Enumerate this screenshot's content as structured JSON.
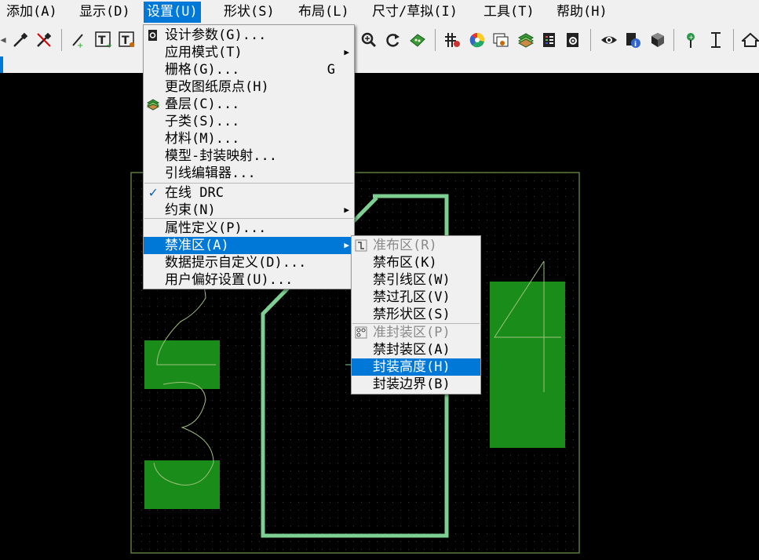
{
  "menubar": {
    "items": [
      {
        "label": "添加(A)"
      },
      {
        "label": "显示(D)"
      },
      {
        "label": "设置(U)"
      },
      {
        "label": "形状(S)"
      },
      {
        "label": "布局(L)"
      },
      {
        "label": "尺寸/草拟(I)"
      },
      {
        "label": "工具(T)"
      },
      {
        "label": "帮助(H)"
      }
    ]
  },
  "settings_menu": {
    "items": [
      {
        "label": "设计参数(G)...",
        "shortcut": "",
        "submenu": false
      },
      {
        "label": "应用模式(T)",
        "shortcut": "",
        "submenu": true
      },
      {
        "label": "栅格(G)...",
        "shortcut": "G",
        "submenu": false
      },
      {
        "label": "更改图纸原点(H)",
        "shortcut": "",
        "submenu": false
      },
      {
        "label": "叠层(C)...",
        "shortcut": "",
        "submenu": false
      },
      {
        "label": "子类(S)...",
        "shortcut": "",
        "submenu": false
      },
      {
        "label": "材料(M)...",
        "shortcut": "",
        "submenu": false
      },
      {
        "label": "模型-封装映射...",
        "shortcut": "",
        "submenu": false
      },
      {
        "label": "引线编辑器...",
        "shortcut": "",
        "submenu": false
      },
      {
        "label": "在线 DRC",
        "shortcut": "",
        "submenu": false,
        "checked": true
      },
      {
        "label": "约束(N)",
        "shortcut": "",
        "submenu": true
      },
      {
        "label": "属性定义(P)...",
        "shortcut": "",
        "submenu": false
      },
      {
        "label": "禁准区(A)",
        "shortcut": "",
        "submenu": true
      },
      {
        "label": "数据提示自定义(D)...",
        "shortcut": "",
        "submenu": false
      },
      {
        "label": "用户偏好设置(U)...",
        "shortcut": "",
        "submenu": false
      }
    ]
  },
  "areas_submenu": {
    "items": [
      {
        "label": "准布区(R)",
        "disabled": true
      },
      {
        "label": "禁布区(K)",
        "disabled": false
      },
      {
        "label": "禁引线区(W)",
        "disabled": false
      },
      {
        "label": "禁过孔区(V)",
        "disabled": false
      },
      {
        "label": "禁形状区(S)",
        "disabled": false
      },
      {
        "label": "准封装区(P)",
        "disabled": true
      },
      {
        "label": "禁封装区(A)",
        "disabled": false
      },
      {
        "label": "封装高度(H)",
        "disabled": false
      },
      {
        "label": "封装边界(B)",
        "disabled": false
      }
    ]
  },
  "canvas": {
    "pad_labels": [
      "2",
      "3",
      "4"
    ]
  },
  "colors": {
    "accent": "#0078d7",
    "menu_bg": "#f0f0f0",
    "pad_green": "#1a8c1a",
    "outline_green": "#7ecf92",
    "board_outline": "#5a7a3a"
  }
}
